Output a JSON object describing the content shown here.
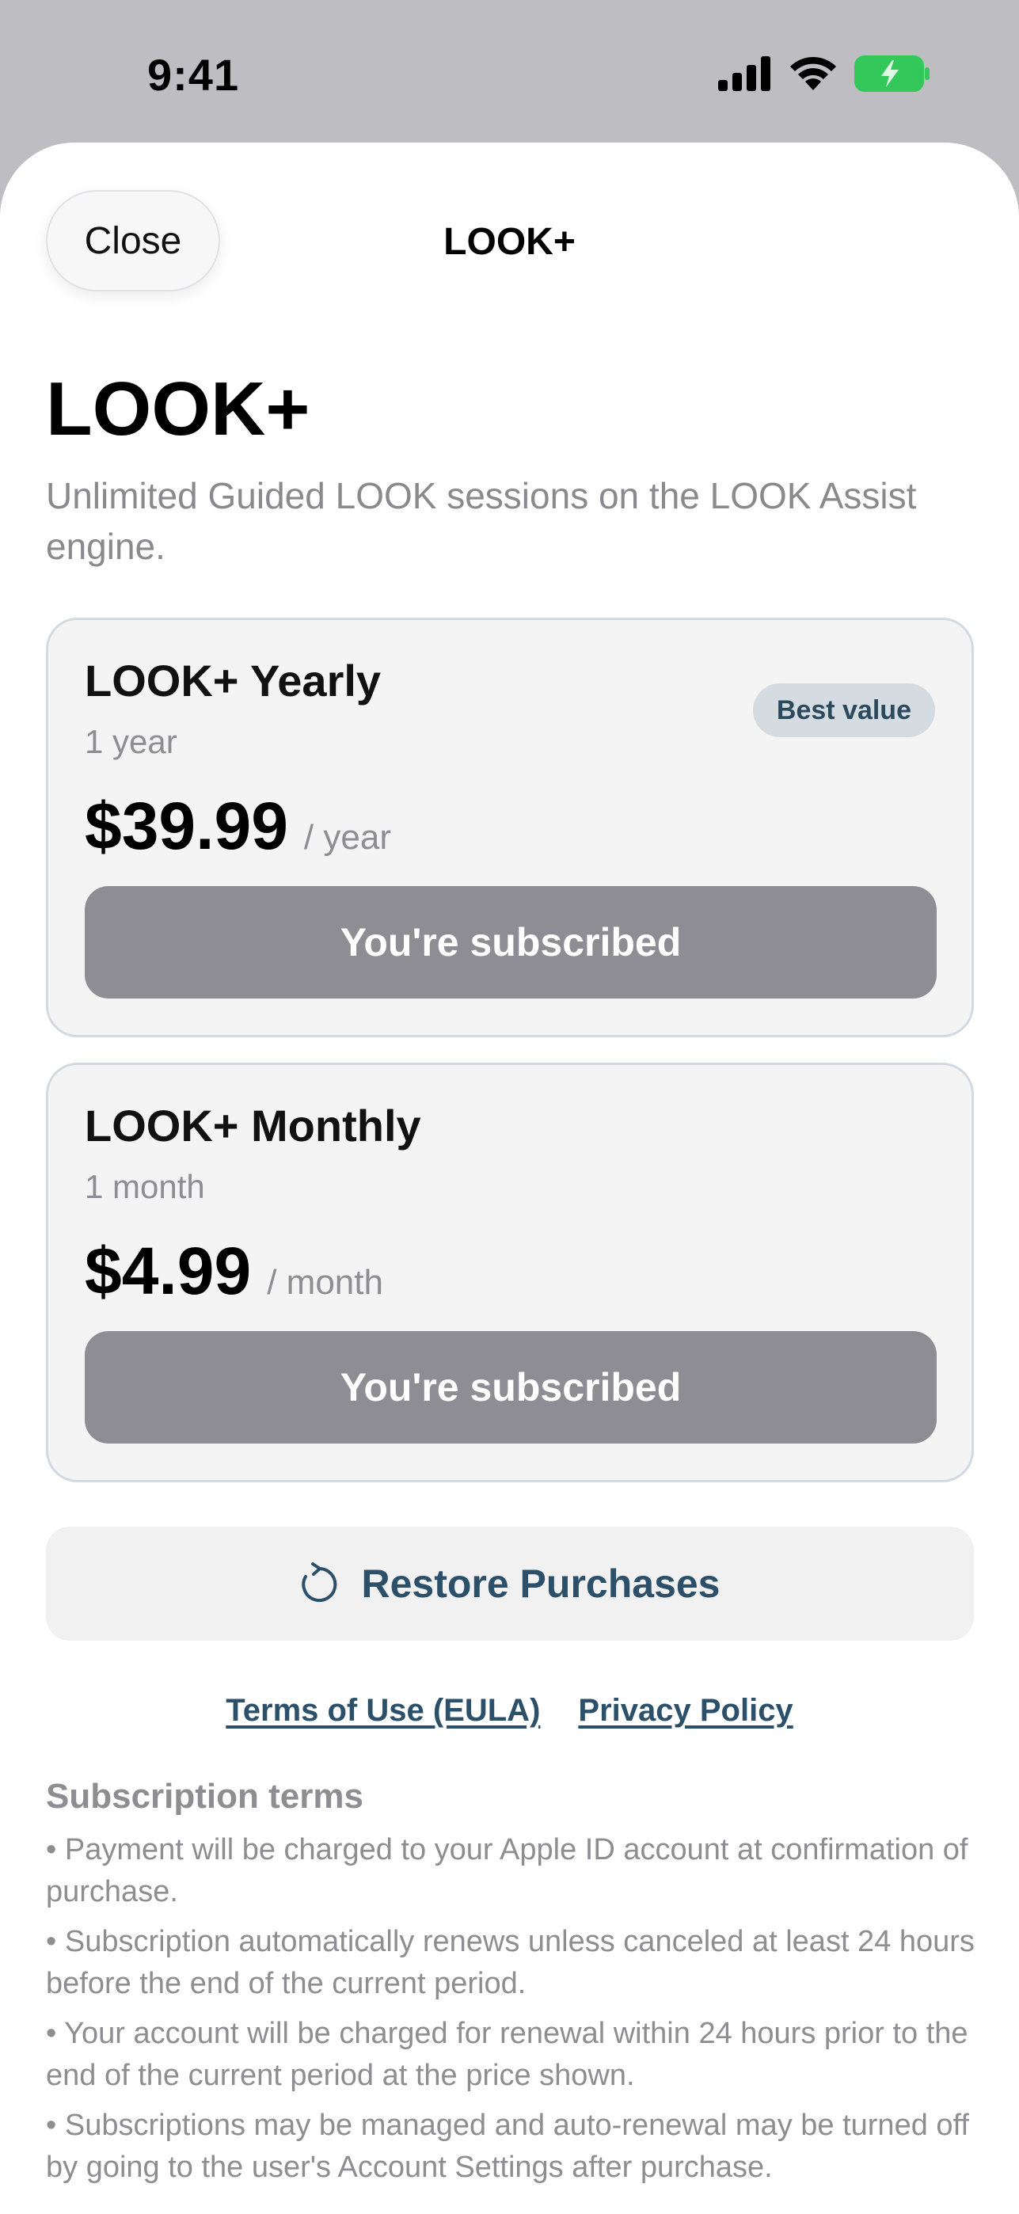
{
  "status_bar": {
    "time": "9:41"
  },
  "header": {
    "close_label": "Close",
    "nav_title": "LOOK+"
  },
  "main": {
    "title": "LOOK+",
    "subtitle": "Unlimited Guided LOOK sessions on the LOOK Assist engine."
  },
  "plans": [
    {
      "name": "LOOK+ Yearly",
      "period": "1 year",
      "price": "$39.99",
      "unit": "/ year",
      "badge": "Best value",
      "button_label": "You're subscribed"
    },
    {
      "name": "LOOK+ Monthly",
      "period": "1 month",
      "price": "$4.99",
      "unit": "/ month",
      "button_label": "You're subscribed"
    }
  ],
  "restore": {
    "label": "Restore Purchases",
    "icon": "refresh-icon"
  },
  "links": {
    "terms": "Terms of Use (EULA)",
    "privacy": "Privacy Policy"
  },
  "terms": {
    "heading": "Subscription terms",
    "items": [
      "• Payment will be charged to your Apple ID account at confirmation of purchase.",
      "• Subscription automatically renews unless canceled at least 24 hours before the end of the current period.",
      "• Your account will be charged for renewal within 24 hours prior to the end of the current period at the price shown.",
      "• Subscriptions may be managed and auto-renewal may be turned off by going to the user's Account Settings after purchase."
    ]
  },
  "colors": {
    "accent": "#2c5069",
    "subscribed_button": "#8e8d93",
    "battery": "#34c759"
  }
}
